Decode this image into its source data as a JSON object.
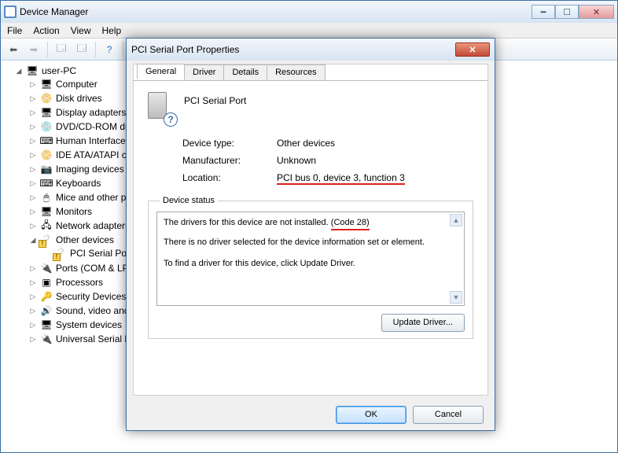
{
  "main_window": {
    "title": "Device Manager",
    "menus": [
      "File",
      "Action",
      "View",
      "Help"
    ],
    "root": "user-PC",
    "categories": [
      {
        "label": "Computer",
        "icon": "🖥"
      },
      {
        "label": "Disk drives",
        "icon": "📀"
      },
      {
        "label": "Display adapters",
        "icon": "🖥"
      },
      {
        "label": "DVD/CD-ROM drives",
        "icon": "💿"
      },
      {
        "label": "Human Interface Devices",
        "icon": "⌨"
      },
      {
        "label": "IDE ATA/ATAPI controllers",
        "icon": "📀"
      },
      {
        "label": "Imaging devices",
        "icon": "📷"
      },
      {
        "label": "Keyboards",
        "icon": "⌨"
      },
      {
        "label": "Mice and other pointing devices",
        "icon": "🖱"
      },
      {
        "label": "Monitors",
        "icon": "🖥"
      },
      {
        "label": "Network adapters",
        "icon": "🖧"
      }
    ],
    "other_devices": {
      "label": "Other devices",
      "child": "PCI Serial Port"
    },
    "categories2": [
      {
        "label": "Ports (COM & LPT)",
        "icon": "🔌"
      },
      {
        "label": "Processors",
        "icon": "▣"
      },
      {
        "label": "Security Devices",
        "icon": "🔑"
      },
      {
        "label": "Sound, video and game controllers",
        "icon": "🔊"
      },
      {
        "label": "System devices",
        "icon": "🖥"
      },
      {
        "label": "Universal Serial Bus controllers",
        "icon": "🔌"
      }
    ]
  },
  "dialog": {
    "title": "PCI Serial Port Properties",
    "tabs": [
      "General",
      "Driver",
      "Details",
      "Resources"
    ],
    "device_name": "PCI Serial Port",
    "rows": {
      "type_l": "Device type:",
      "type_v": "Other devices",
      "mfr_l": "Manufacturer:",
      "mfr_v": "Unknown",
      "loc_l": "Location:",
      "loc_v": "PCI bus 0, device 3, function 3"
    },
    "status_legend": "Device status",
    "status_line1a": "The drivers for this device are not installed.",
    "status_line1b": "(Code 28)",
    "status_line2": "There is no driver selected for the device information set or element.",
    "status_line3": "To find a driver for this device, click Update Driver.",
    "update_btn": "Update Driver...",
    "ok": "OK",
    "cancel": "Cancel"
  }
}
